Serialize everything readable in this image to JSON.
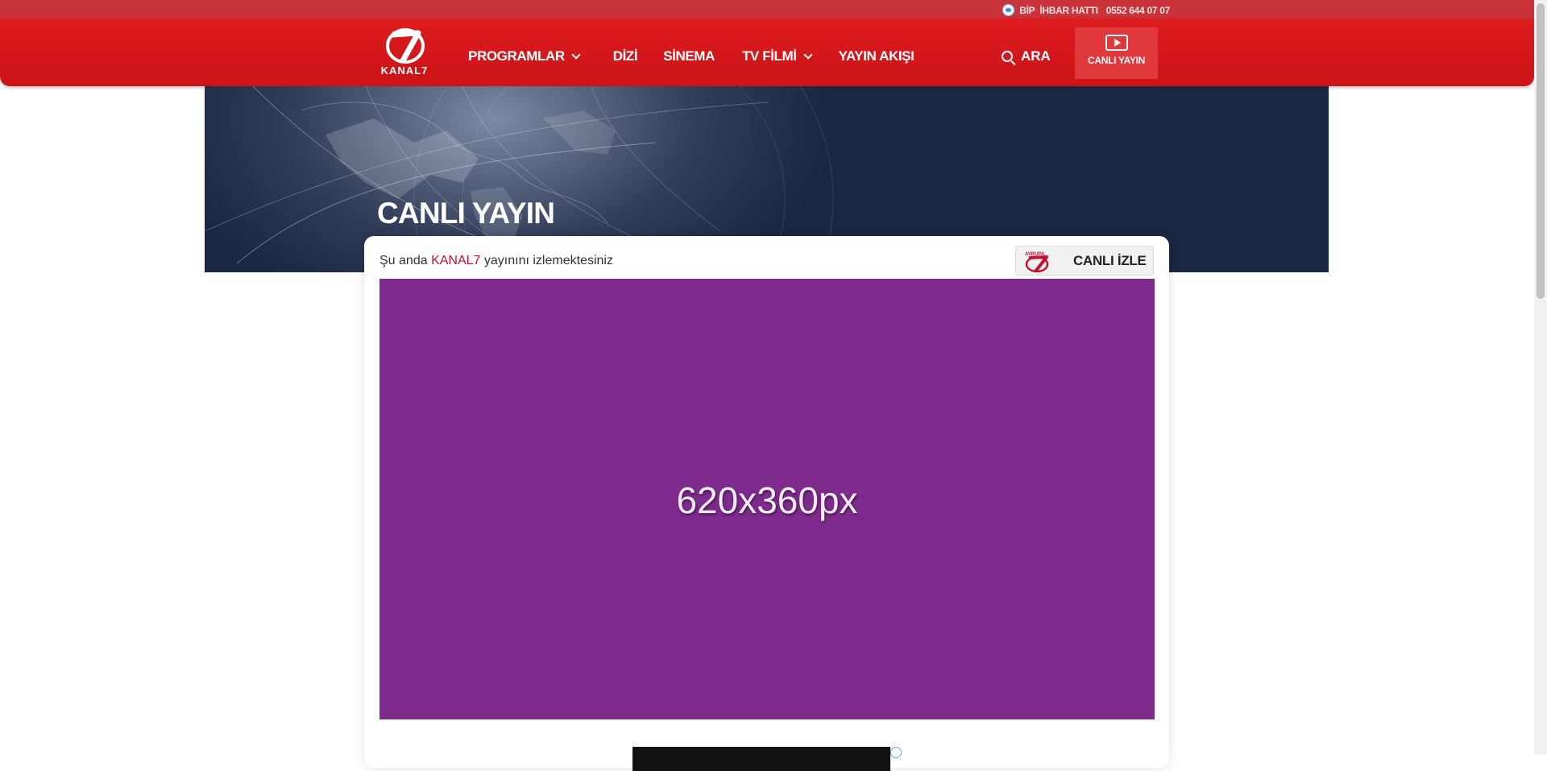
{
  "topbar": {
    "bip_label": "BİP",
    "hotline_label": "İHBAR HATTI",
    "phone": "0552 644 07 07"
  },
  "brand": {
    "logo_text": "KANAL7"
  },
  "nav": {
    "items": [
      {
        "label": "PROGRAMLAR",
        "has_dropdown": true
      },
      {
        "label": "DİZİ",
        "has_dropdown": false
      },
      {
        "label": "SİNEMA",
        "has_dropdown": false
      },
      {
        "label": "TV FİLMİ",
        "has_dropdown": true
      },
      {
        "label": "YAYIN AKIŞI",
        "has_dropdown": false
      }
    ],
    "search_label": "ARA",
    "live_label": "CANLI YAYIN"
  },
  "hero": {
    "title": "CANLI YAYIN"
  },
  "card": {
    "watching_prefix": "Şu anda",
    "watching_brand": "KANAL7",
    "watching_suffix": "yayınını izlemektesiniz",
    "watch_live_label": "CANLI İZLE",
    "avrupa_logo_text": "AVRUPA",
    "player_placeholder": "620x360px"
  },
  "colors": {
    "nav_red": "#d4181b",
    "topbar_red": "#c93339",
    "player_purple": "#7f2b8e",
    "brand_red": "#c8102e"
  }
}
